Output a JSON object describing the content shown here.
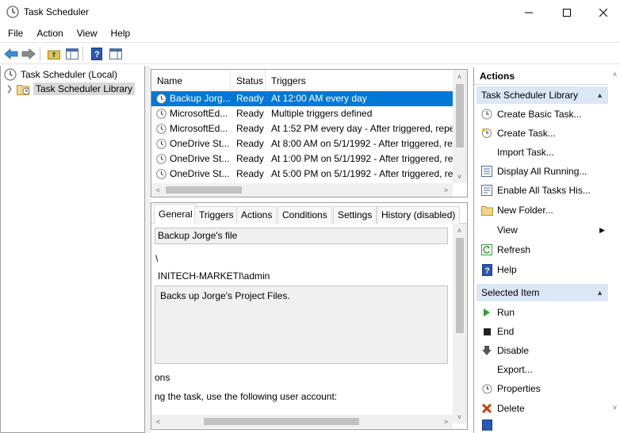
{
  "window": {
    "title": "Task Scheduler"
  },
  "menu": [
    "File",
    "Action",
    "View",
    "Help"
  ],
  "tree": {
    "root": "Task Scheduler (Local)",
    "library": "Task Scheduler Library"
  },
  "task_list": {
    "columns": [
      "Name",
      "Status",
      "Triggers"
    ],
    "rows": [
      {
        "name": "Backup Jorg...",
        "status": "Ready",
        "trigger": "At 12:00 AM every day"
      },
      {
        "name": "MicrosoftEd...",
        "status": "Ready",
        "trigger": "Multiple triggers defined"
      },
      {
        "name": "MicrosoftEd...",
        "status": "Ready",
        "trigger": "At 1:52 PM every day - After triggered, repe"
      },
      {
        "name": "OneDrive St...",
        "status": "Ready",
        "trigger": "At 8:00 AM on 5/1/1992 - After triggered, re"
      },
      {
        "name": "OneDrive St...",
        "status": "Ready",
        "trigger": "At 1:00 PM on 5/1/1992 - After triggered, re"
      },
      {
        "name": "OneDrive St...",
        "status": "Ready",
        "trigger": "At 5:00 PM on 5/1/1992 - After triggered, re"
      }
    ]
  },
  "details": {
    "tabs": [
      "General",
      "Triggers",
      "Actions",
      "Conditions",
      "Settings",
      "History (disabled)"
    ],
    "name_value": "Backup Jorge's file",
    "location_value": "\\",
    "author_value": "INITECH-MARKETI\\admin",
    "description_value": "Backs up Jorge's Project Files.",
    "security_label_partial": "ons",
    "security_text_partial": "ng the task, use the following user account:"
  },
  "actions": {
    "title": "Actions",
    "group1": "Task Scheduler Library",
    "items1": [
      {
        "label": "Create Basic Task...",
        "icon": "create-basic-task-icon"
      },
      {
        "label": "Create Task...",
        "icon": "create-task-icon"
      },
      {
        "label": "Import Task...",
        "icon": ""
      },
      {
        "label": "Display All Running...",
        "icon": "display-running-icon"
      },
      {
        "label": "Enable All Tasks His...",
        "icon": "enable-history-icon"
      },
      {
        "label": "New Folder...",
        "icon": "folder-icon"
      },
      {
        "label": "View",
        "icon": ""
      },
      {
        "label": "Refresh",
        "icon": "refresh-icon"
      },
      {
        "label": "Help",
        "icon": "help-icon"
      }
    ],
    "group2": "Selected Item",
    "items2": [
      {
        "label": "Run",
        "icon": "run-icon"
      },
      {
        "label": "End",
        "icon": "end-icon"
      },
      {
        "label": "Disable",
        "icon": "disable-icon"
      },
      {
        "label": "Export...",
        "icon": ""
      },
      {
        "label": "Properties",
        "icon": "properties-icon"
      },
      {
        "label": "Delete",
        "icon": "delete-icon"
      }
    ]
  },
  "colors": {
    "selection": "#0078d7",
    "group_header": "#dbe7f5",
    "delete": "#d83b01",
    "run": "#2e9e2e"
  }
}
